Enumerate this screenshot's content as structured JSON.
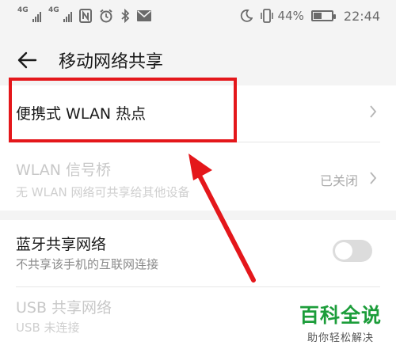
{
  "status_bar": {
    "signal1_label": "4G",
    "signal2_label": "4G",
    "battery_percent": "44%",
    "battery_level": 0.44,
    "time": "22:44"
  },
  "header": {
    "title": "移动网络共享"
  },
  "rows": [
    {
      "label": "便携式 WLAN 热点",
      "enabled": true
    },
    {
      "label": "WLAN 信号桥",
      "subtitle": "无 WLAN 网络可共享给其他设备",
      "status": "已关闭",
      "enabled": false
    },
    {
      "label": "蓝牙共享网络",
      "subtitle": "不共享该手机的互联网连接",
      "toggle_on": false,
      "enabled": true
    },
    {
      "label": "USB 共享网络",
      "subtitle": "USB 未连接",
      "enabled": false
    }
  ],
  "watermark": {
    "title": "百科全说",
    "subtitle": "助你轻松解决"
  },
  "colors": {
    "highlight": "#e4171b",
    "arrow": "#e4171b",
    "watermark": "#1c9d3a"
  }
}
